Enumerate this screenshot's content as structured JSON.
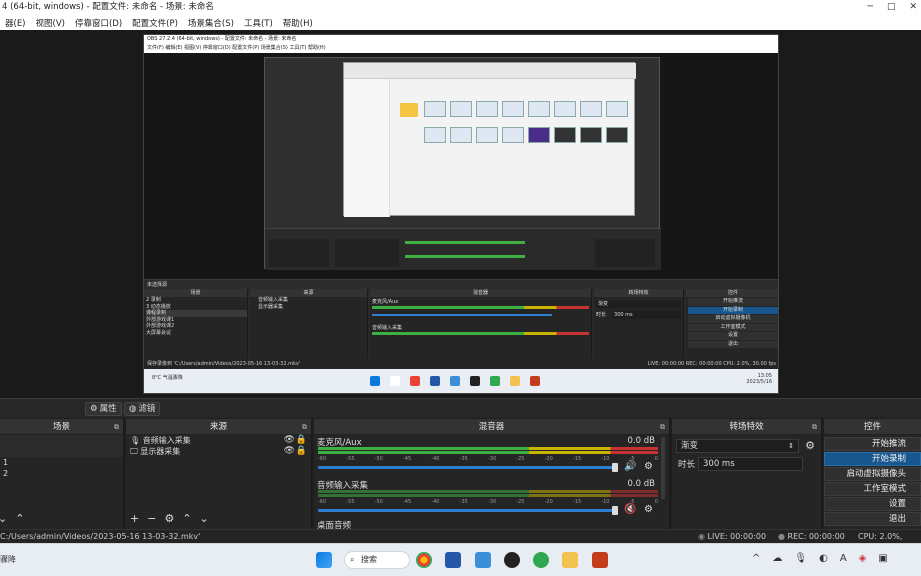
{
  "window": {
    "title": "4 (64-bit, windows) - 配置文件: 未命名 - 场景: 未命名",
    "controls": [
      "─",
      "□",
      "✕"
    ]
  },
  "menu": [
    "器(E)",
    "视图(V)",
    "停靠窗口(D)",
    "配置文件(P)",
    "场景集合(S)",
    "工具(T)",
    "帮助(H)"
  ],
  "nested": {
    "title": "OBS 27.2.4 (64-bit, windows) - 配置文件: 未命名 - 场景: 未命名",
    "menu": "文件(F)  编辑(E)  视图(V)  停靠窗口(D)  配置文件(P)  场景集合(S)  工具(T)  帮助(H)",
    "scenes_title": "场景",
    "sources_title": "来源",
    "mixer_title": "混音器",
    "transitions_title": "转场特效",
    "controls_title": "控件",
    "no_source": "未选择源",
    "scenes": [
      "2 录制",
      "3 动态播放",
      "课程录制",
      "外部游戏课1",
      "外部游戏课2",
      "大屏幕会议"
    ],
    "sources": [
      "音频输入采集",
      "显示器采集"
    ],
    "mic_label": "麦克风/Aux",
    "audio_label": "音频输入采集",
    "transition": "渐变",
    "duration_label": "时长",
    "duration": "300 ms",
    "ctrl_buttons": [
      "开始推流",
      "开始录制",
      "启动虚拟摄像机",
      "工作室模式",
      "设置",
      "退出"
    ],
    "status_path": "保存录像到 'C:/Users/admin/Videos/2023-05-16 13-03-32.mkv'",
    "status_right": "LIVE: 00:00:00   REC: 00:00:00   CPU: 2.0%, 30.00 fps",
    "weather": "8°C  气温骤降",
    "time": "13:05",
    "date": "2023/5/16"
  },
  "toolbar": {
    "properties": "属性",
    "filters": "滤镜"
  },
  "scenes": {
    "title": "场景",
    "items": [
      "1",
      "2"
    ]
  },
  "sources": {
    "title": "来源",
    "items": [
      {
        "name": "音频输入采集",
        "icon": "mic-icon"
      },
      {
        "name": "显示器采集",
        "icon": "monitor-icon"
      }
    ]
  },
  "mixer": {
    "title": "混音器",
    "channels": [
      {
        "name": "麦克风/Aux",
        "db": "0.0 dB"
      },
      {
        "name": "音频输入采集",
        "db": "0.0 dB"
      },
      {
        "name": "桌面音频"
      }
    ],
    "ticks": [
      "-60",
      "-55",
      "-50",
      "-45",
      "-40",
      "-35",
      "-30",
      "-25",
      "-20",
      "-15",
      "-10",
      "-5",
      "0"
    ]
  },
  "transitions": {
    "title": "转场特效",
    "selected": "渐变",
    "duration_label": "时长",
    "duration": "300 ms"
  },
  "controls": {
    "title": "控件",
    "buttons": [
      "开始推流",
      "开始录制",
      "启动虚拟摄像头",
      "工作室模式",
      "设置",
      "退出"
    ],
    "active_index": 1
  },
  "status": {
    "path": "C:/Users/admin/Videos/2023-05-16 13-03-32.mkv'",
    "live": "LIVE: 00:00:00",
    "rec": "REC: 00:00:00",
    "cpu": "CPU: 2.0%, 30.00"
  },
  "taskbar": {
    "weather": "骤降",
    "search": "搜索",
    "tray_letter": "A"
  },
  "colors": {
    "meter_green": "#3cb043",
    "meter_yellow": "#c8b400",
    "meter_red": "#c83232",
    "volume_blue": "#2f7fd0",
    "active_button": "#17578d"
  }
}
